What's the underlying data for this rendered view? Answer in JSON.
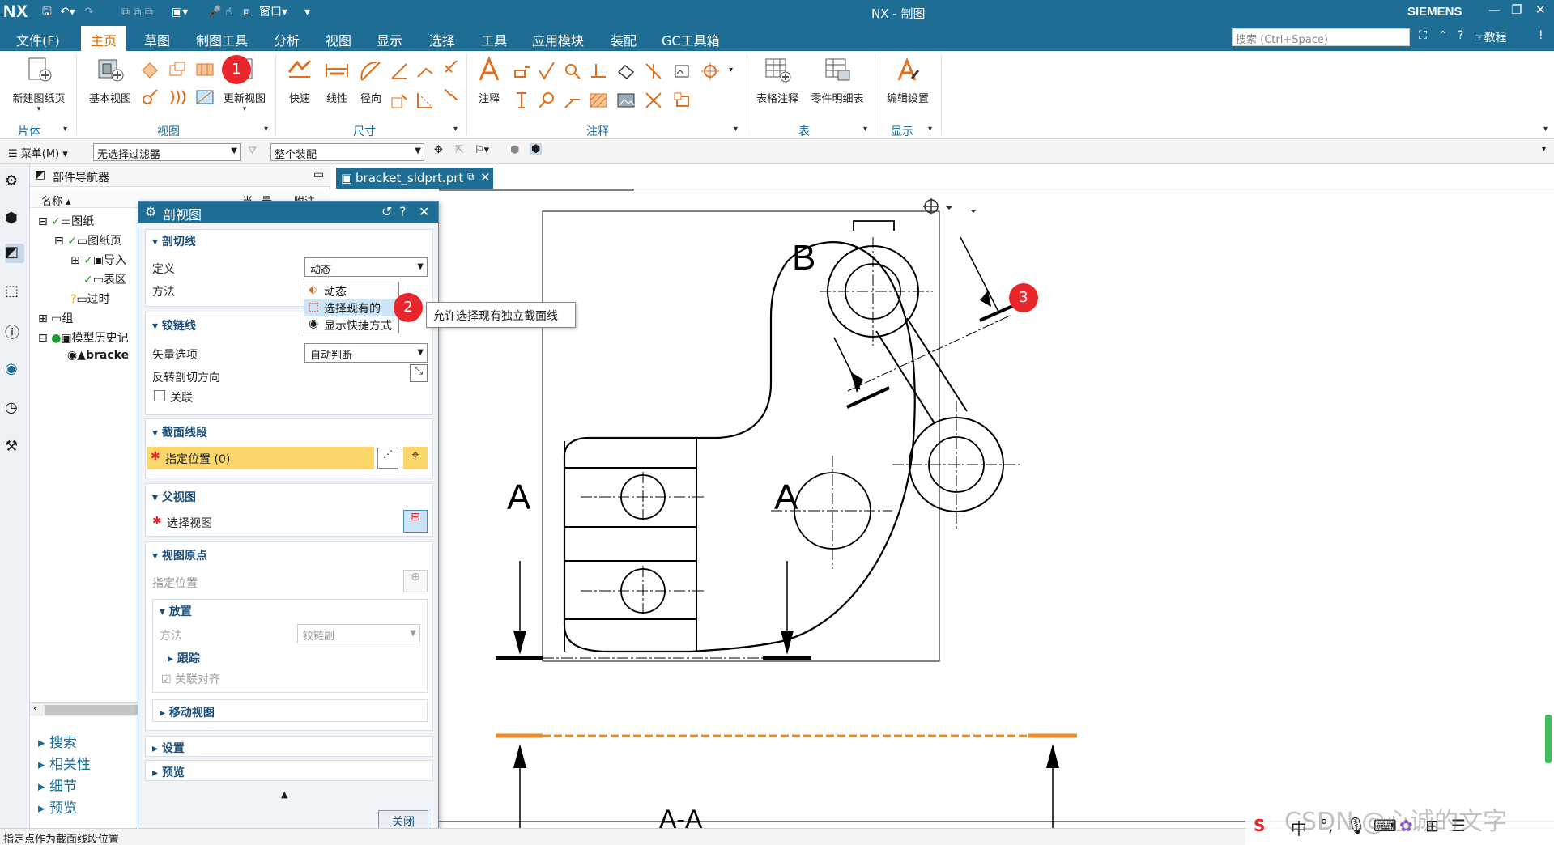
{
  "titlebar": {
    "logo": "NX",
    "window_menu": "窗口",
    "title": "NX - 制图",
    "brand": "SIEMENS"
  },
  "menu": {
    "tabs": [
      "文件(F)",
      "主页",
      "草图",
      "制图工具",
      "分析",
      "视图",
      "显示",
      "选择",
      "工具",
      "应用模块",
      "装配",
      "GC工具箱"
    ],
    "active_tab": "主页",
    "search_placeholder": "搜索 (Ctrl+Space)",
    "tutorial": "教程"
  },
  "ribbon": {
    "new_sheet": "新建图纸页",
    "base_view": "基本视图",
    "update_view": "更新视图",
    "quick": "快速",
    "linear": "线性",
    "radial": "径向",
    "note": "注释",
    "table_note": "表格注释",
    "parts_list": "零件明细表",
    "edit_settings": "编辑设置",
    "groups": [
      "片体",
      "视图",
      "尺寸",
      "注释",
      "表",
      "显示"
    ]
  },
  "filterbar": {
    "menu": "菜单(M)",
    "filter": "无选择过滤器",
    "scope": "整个装配"
  },
  "partnav": {
    "title": "部件导航器",
    "col_name": "名称",
    "col_current": "当",
    "col_latest": "最",
    "col_note": "附注",
    "tree": [
      "图纸",
      "图纸页",
      "导入",
      "表区",
      "过时",
      "组",
      "模型历史记",
      "bracke"
    ],
    "footer": [
      "搜索",
      "相关性",
      "细节",
      "预览"
    ]
  },
  "dialog": {
    "title": "剖视图",
    "section_cut_line": "剖切线",
    "define_label": "定义",
    "define_value": "动态",
    "method_label": "方法",
    "dropdown_options": [
      "动态",
      "选择现有的",
      "显示快捷方式"
    ],
    "tooltip": "允许选择现有独立截面线",
    "section_hinge": "铰链线",
    "vector_label": "矢量选项",
    "vector_value": "自动判断",
    "reverse_label": "反转剖切方向",
    "associative_label": "关联",
    "section_segment": "截面线段",
    "specify_location": "指定位置 (0)",
    "section_parent": "父视图",
    "select_view": "选择视图",
    "section_origin": "视图原点",
    "origin_specify": "指定位置",
    "placement": "放置",
    "placement_method_label": "方法",
    "placement_method_value": "铰链副",
    "track": "跟踪",
    "align_assoc": "关联对齐",
    "move_view": "移动视图",
    "settings": "设置",
    "preview": "预览",
    "close": "关闭"
  },
  "callouts": [
    "1",
    "2",
    "3"
  ],
  "document_tab": "bracket_sldprt.prt",
  "drawing": {
    "label_b": "B",
    "label_a_left": "A",
    "label_a_right": "A",
    "label_aa": "A-A"
  },
  "statusbar": {
    "text": "指定点作为截面线段位置"
  },
  "ime": {
    "lang": "中"
  },
  "watermark": "CSDN @心诚的文字",
  "colors": {
    "titlebar": "#1e6d94",
    "accent_orange": "#f08a24",
    "badge_red": "#e8262b",
    "highlight_yellow": "#fbd66a"
  }
}
